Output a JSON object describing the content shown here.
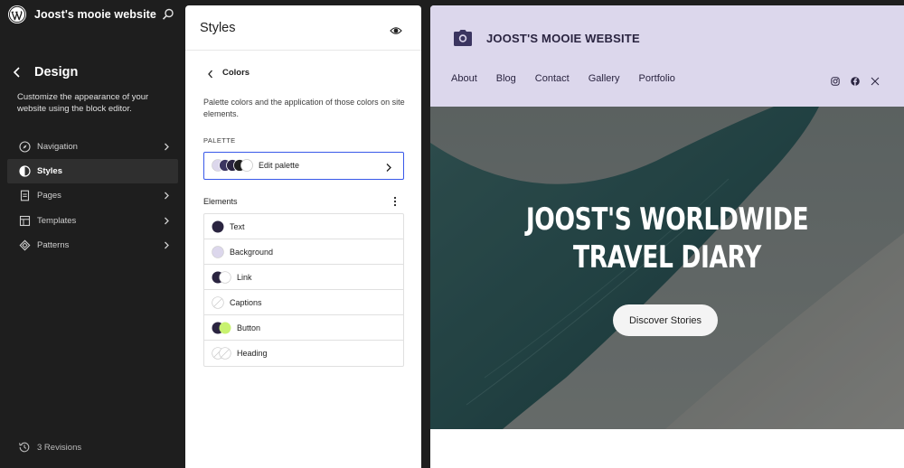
{
  "sidebar": {
    "site_name": "Joost's mooie website",
    "icons": {
      "logo": "wordpress-logo-icon",
      "search": "search-icon",
      "back": "chevron-left-icon"
    },
    "section_title": "Design",
    "description": "Customize the appearance of your website using the block editor.",
    "items": [
      {
        "label": "Navigation",
        "icon": "compass-icon",
        "has_chevron": true,
        "active": false
      },
      {
        "label": "Styles",
        "icon": "half-circle-icon",
        "has_chevron": false,
        "active": true
      },
      {
        "label": "Pages",
        "icon": "page-icon",
        "has_chevron": true,
        "active": false
      },
      {
        "label": "Templates",
        "icon": "layout-icon",
        "has_chevron": true,
        "active": false
      },
      {
        "label": "Patterns",
        "icon": "diamond-icon",
        "has_chevron": true,
        "active": false
      }
    ],
    "revisions_label": "3 Revisions"
  },
  "styles_panel": {
    "title": "Styles",
    "colors_title": "Colors",
    "colors_description": "Palette colors and the application of those colors on site elements.",
    "palette_label": "PALETTE",
    "palette_button_label": "Edit palette",
    "palette_colors": [
      "#dcd7ec",
      "#3b3560",
      "#2a2440",
      "#1e1e1e",
      "#ffffff"
    ],
    "elements_label": "Elements",
    "elements": [
      {
        "label": "Text",
        "colors": [
          "#2a2440"
        ]
      },
      {
        "label": "Background",
        "colors": [
          "#dcd7ec"
        ]
      },
      {
        "label": "Link",
        "colors": [
          "#2a2440",
          "#ffffff"
        ]
      },
      {
        "label": "Captions",
        "colors": []
      },
      {
        "label": "Button",
        "colors": [
          "#2a2440",
          "#c8f270"
        ]
      },
      {
        "label": "Heading",
        "colors": []
      }
    ]
  },
  "preview": {
    "site_title": "JOOST'S MOOIE WEBSITE",
    "nav": [
      "About",
      "Blog",
      "Contact",
      "Gallery",
      "Portfolio"
    ],
    "social_icons": [
      "instagram-icon",
      "facebook-icon",
      "x-icon"
    ],
    "hero_title_line1": "JOOST'S WORLDWIDE",
    "hero_title_line2": "TRAVEL DIARY",
    "hero_button": "Discover Stories"
  },
  "colors": {
    "accent": "#3858e9",
    "header_bg": "#dcd7ec",
    "dark_text": "#2a2440",
    "button_lime": "#c8f270"
  }
}
